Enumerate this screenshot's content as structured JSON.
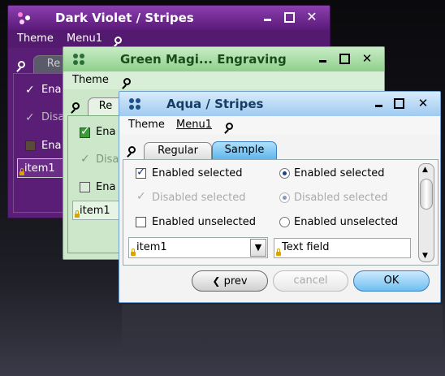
{
  "colors": {
    "violet": "#6e2a8a",
    "green": "#8fd08c",
    "aqua": "#9fcaf0",
    "selected_tab": "#7cc0ef"
  },
  "windows": {
    "violet": {
      "title": "Dark Violet / Stripes",
      "menu": [
        "Theme",
        "Menu1"
      ],
      "tab": "Re",
      "rows": [
        {
          "label": "Ena",
          "checked": true
        },
        {
          "label": "Disa",
          "checked": true
        },
        {
          "label": "Ena",
          "checked": false
        }
      ],
      "combo": "item1"
    },
    "green": {
      "title": "Green Magi... Engraving",
      "menu": [
        "Theme"
      ],
      "tab": "Re",
      "rows": [
        {
          "label": "Ena",
          "checked": true
        },
        {
          "label": "Disa",
          "checked": true
        },
        {
          "label": "Ena",
          "checked": false
        }
      ],
      "combo": "item1"
    },
    "aqua": {
      "title": "Aqua / Stripes",
      "menu": [
        "Theme",
        "Menu1"
      ],
      "tabs": [
        "Regular",
        "Sample"
      ],
      "checkboxes": [
        {
          "label": "Enabled selected",
          "checked": true,
          "enabled": true
        },
        {
          "label": "Disabled selected",
          "checked": true,
          "enabled": false
        },
        {
          "label": "Enabled unselected",
          "checked": false,
          "enabled": true
        }
      ],
      "radios": [
        {
          "label": "Enabled selected",
          "on": true,
          "enabled": true
        },
        {
          "label": "Disabled selected",
          "on": true,
          "enabled": false
        },
        {
          "label": "Enabled unselected",
          "on": false,
          "enabled": true
        }
      ],
      "combo": "item1",
      "text_field": "Text field",
      "buttons": {
        "prev": "prev",
        "cancel": "cancel",
        "ok": "OK"
      }
    }
  },
  "icons": [
    "app-logo-icon",
    "minimize-icon",
    "maximize-icon",
    "close-icon",
    "search-icon",
    "lock-icon",
    "scroll-up-icon",
    "scroll-down-icon",
    "chevron-down-icon"
  ]
}
